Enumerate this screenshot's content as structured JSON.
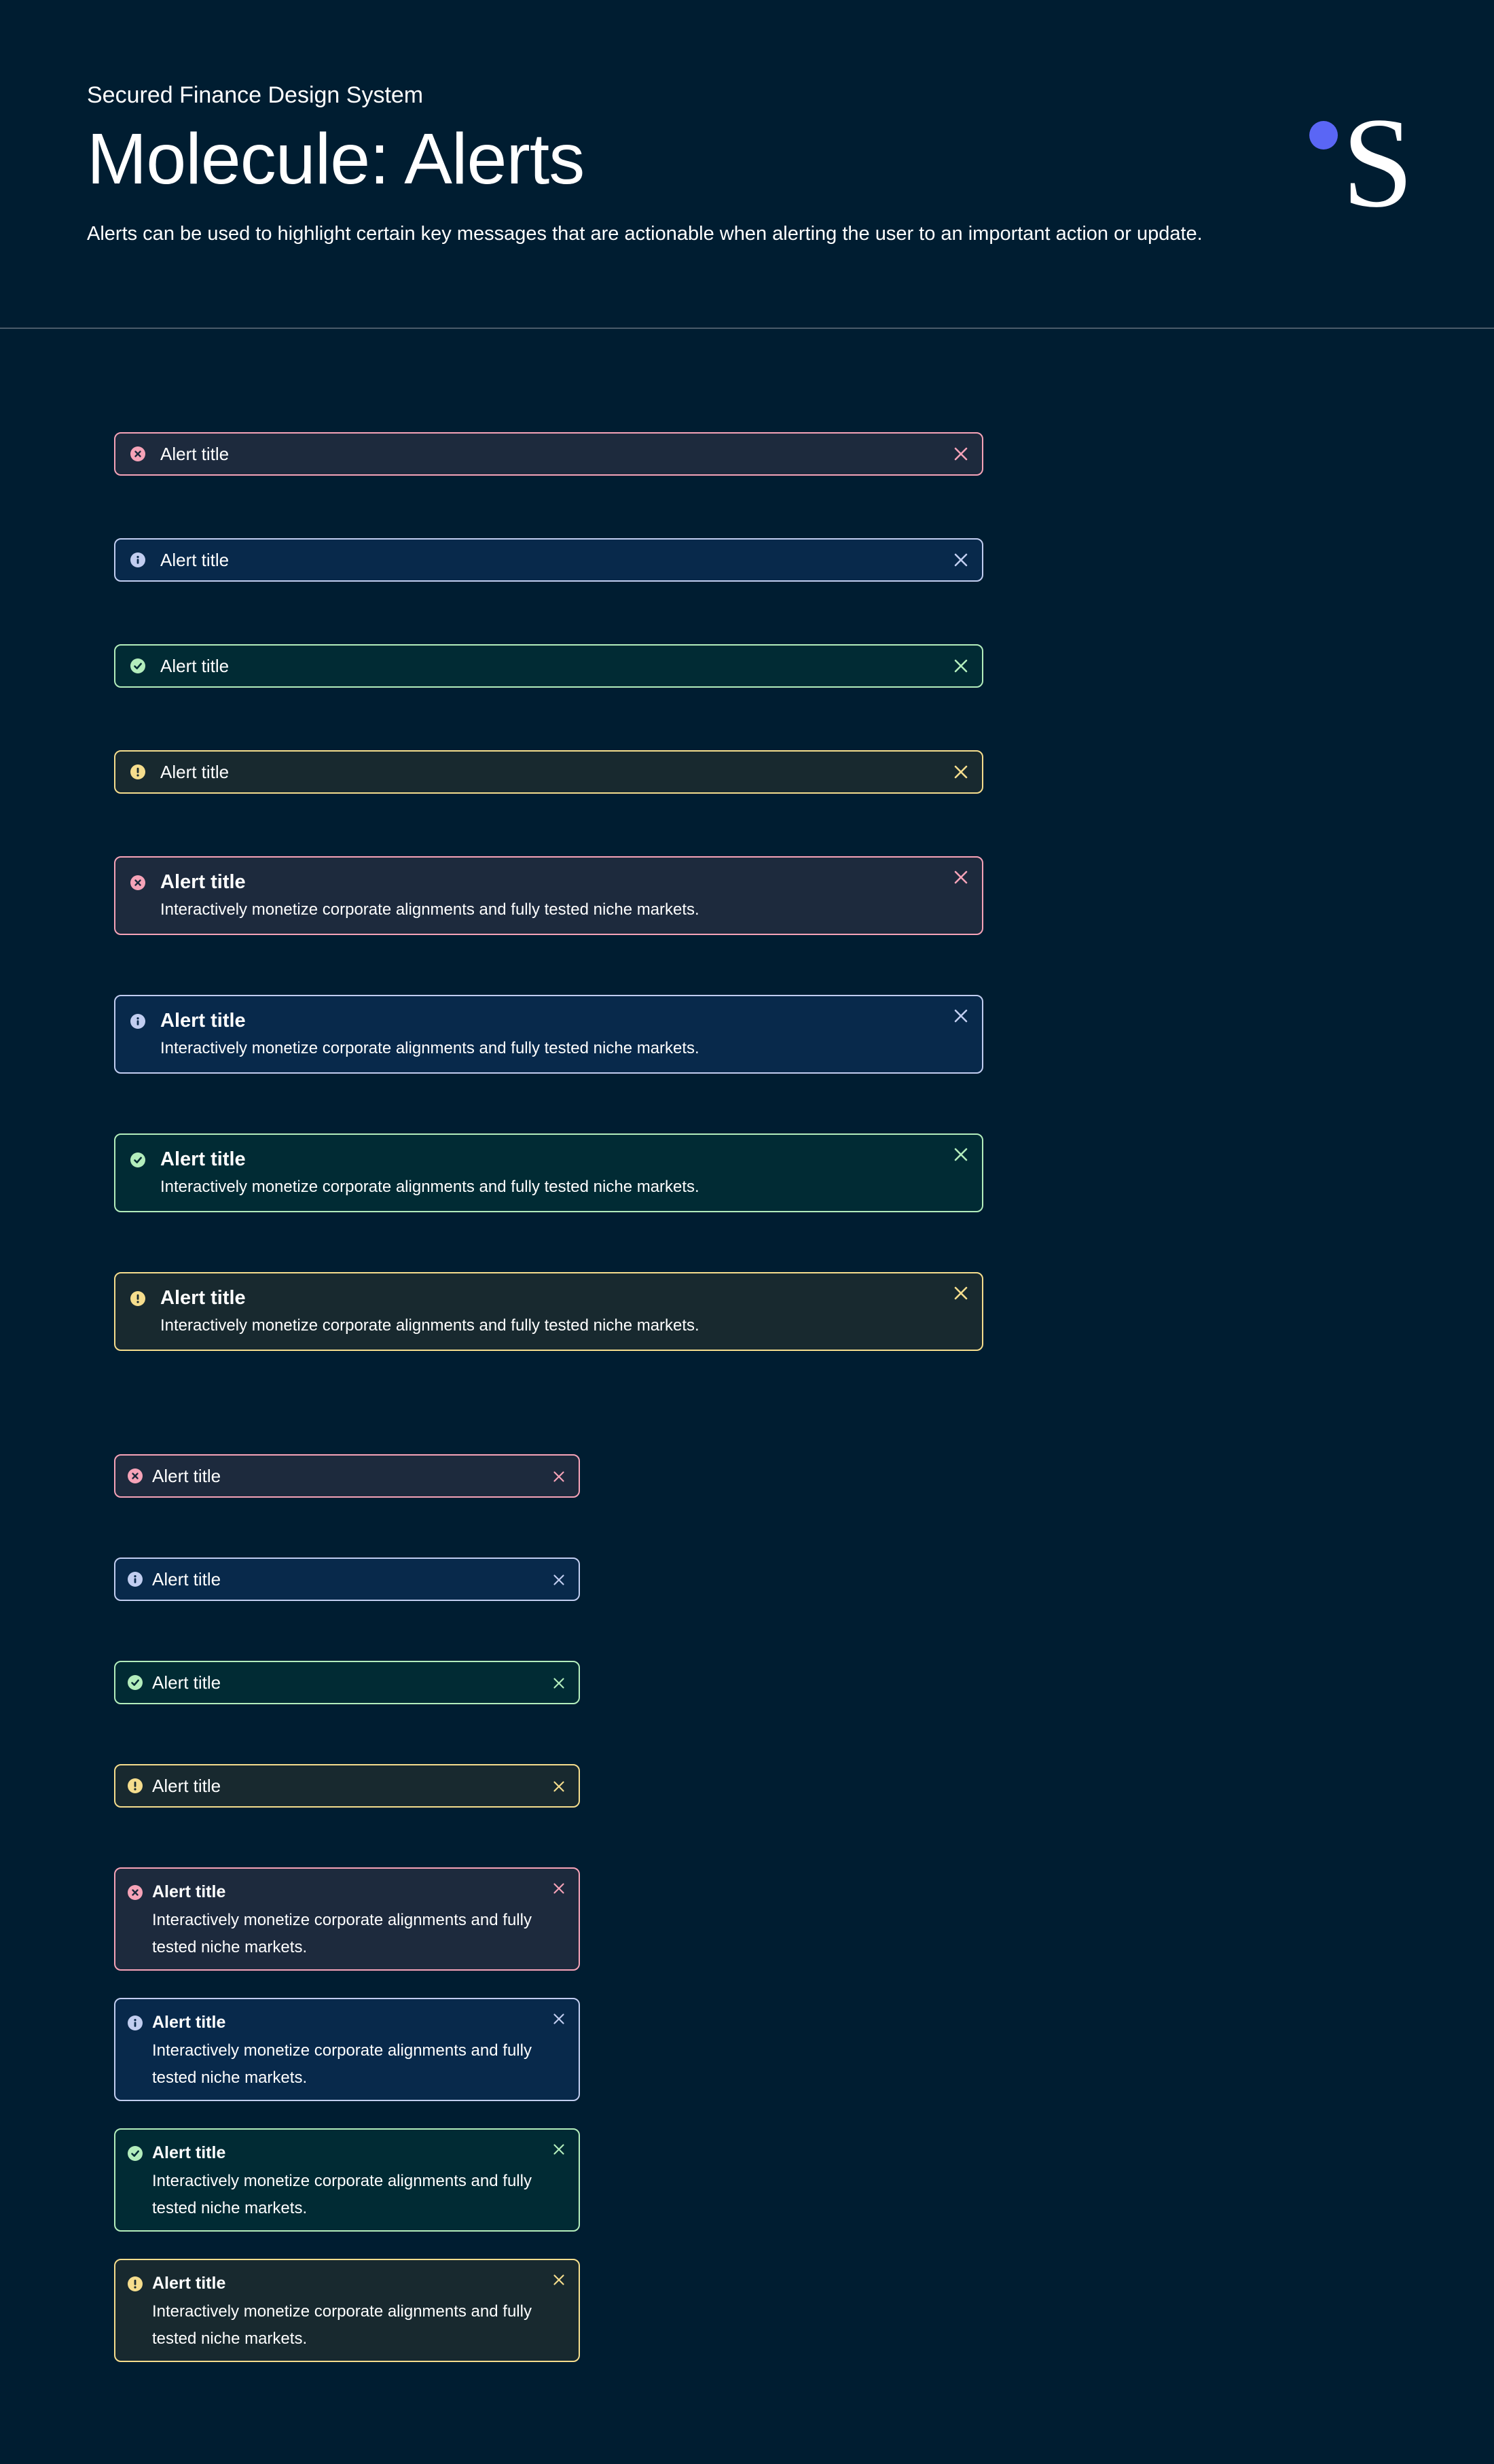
{
  "header": {
    "eyebrow": "Secured Finance Design System",
    "title": "Molecule: Alerts",
    "description": "Alerts can be used to highlight certain key messages that are actionable when alerting the user to an important action or update.",
    "logo_letter": "S"
  },
  "colors": {
    "background": "#001d31",
    "logo_dot": "#5a66f5",
    "error": "#f6a3b8",
    "info": "#c1cdf0",
    "success": "#b3edbc",
    "warning": "#f5dd8d"
  },
  "icons": {
    "error": "x-circle-icon",
    "info": "info-circle-icon",
    "success": "check-circle-icon",
    "warning": "exclamation-circle-icon",
    "dismiss": "close-icon"
  },
  "alerts": {
    "large_compact": [
      {
        "variant": "error",
        "title": "Alert title"
      },
      {
        "variant": "info",
        "title": "Alert title"
      },
      {
        "variant": "success",
        "title": "Alert title"
      },
      {
        "variant": "warning",
        "title": "Alert title"
      }
    ],
    "large_expanded": [
      {
        "variant": "error",
        "title": "Alert title",
        "body": "Interactively monetize corporate alignments and fully tested niche markets."
      },
      {
        "variant": "info",
        "title": "Alert title",
        "body": "Interactively monetize corporate alignments and fully tested niche markets."
      },
      {
        "variant": "success",
        "title": "Alert title",
        "body": "Interactively monetize corporate alignments and fully tested niche markets."
      },
      {
        "variant": "warning",
        "title": "Alert title",
        "body": "Interactively monetize corporate alignments and fully tested niche markets."
      }
    ],
    "small_compact": [
      {
        "variant": "error",
        "title": "Alert title"
      },
      {
        "variant": "info",
        "title": "Alert title"
      },
      {
        "variant": "success",
        "title": "Alert title"
      },
      {
        "variant": "warning",
        "title": "Alert title"
      }
    ],
    "small_expanded": [
      {
        "variant": "error",
        "title": "Alert title",
        "body": "Interactively monetize corporate alignments and fully tested niche markets."
      },
      {
        "variant": "info",
        "title": "Alert title",
        "body": "Interactively monetize corporate alignments and fully tested niche markets."
      },
      {
        "variant": "success",
        "title": "Alert title",
        "body": "Interactively monetize corporate alignments and fully tested niche markets."
      },
      {
        "variant": "warning",
        "title": "Alert title",
        "body": "Interactively monetize corporate alignments and fully tested niche markets."
      }
    ]
  }
}
